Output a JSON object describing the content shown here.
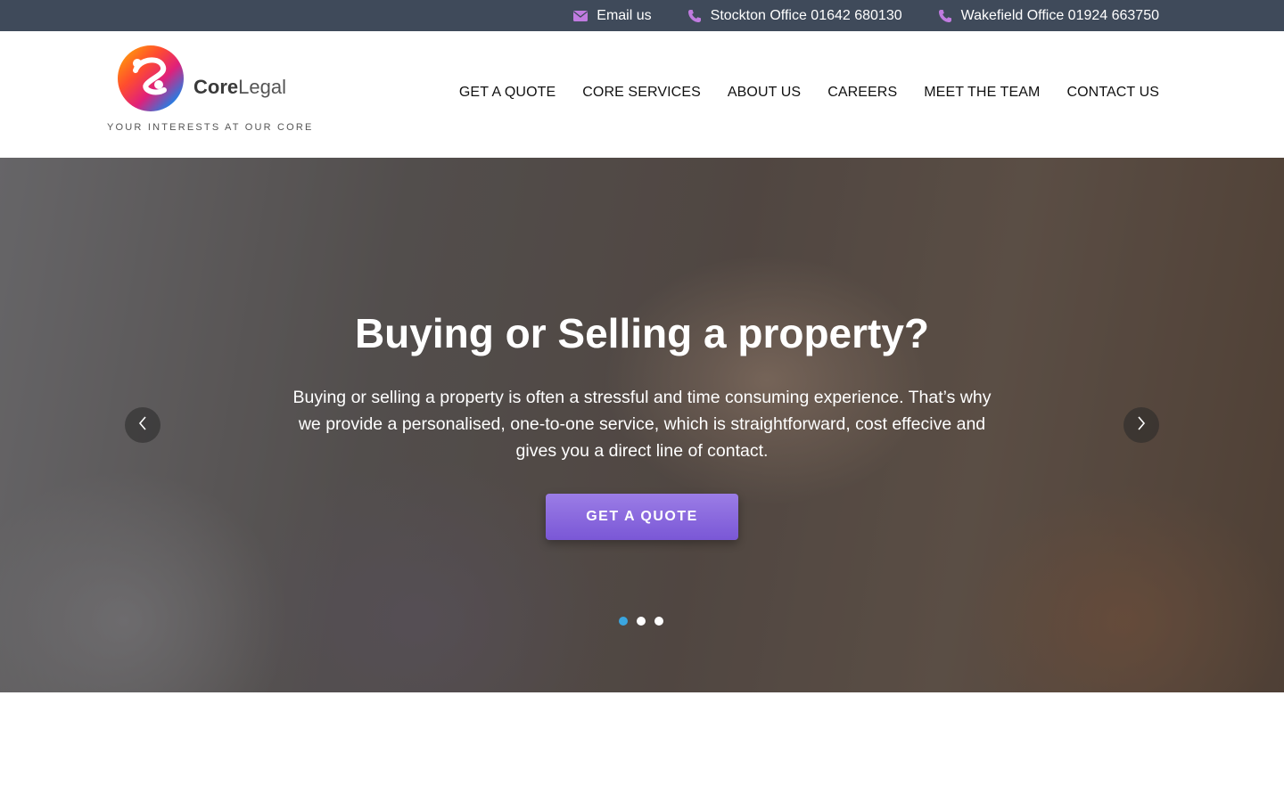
{
  "topbar": {
    "email": {
      "label": "Email us",
      "icon": "envelope-icon"
    },
    "stockton": {
      "label": "Stockton Office 01642 680130",
      "icon": "phone-icon"
    },
    "wakefield": {
      "label": "Wakefield Office 01924 663750",
      "icon": "phone-icon"
    },
    "icon_color": "#c07be0"
  },
  "brand": {
    "name_bold": "Core",
    "name_light": "Legal",
    "tagline": "YOUR INTERESTS AT OUR CORE"
  },
  "nav": {
    "items": [
      {
        "label": "GET A QUOTE"
      },
      {
        "label": "CORE SERVICES"
      },
      {
        "label": "ABOUT US"
      },
      {
        "label": "CAREERS"
      },
      {
        "label": "MEET THE TEAM"
      },
      {
        "label": "CONTACT US"
      }
    ]
  },
  "hero": {
    "title": "Buying or Selling a property?",
    "text": "Buying or selling a property is often a stressful and time consuming experience. That’s why we provide a personalised, one-to-one service, which is straightforward, cost effecive and gives you a direct line of contact.",
    "cta_label": "GET A QUOTE",
    "prev_icon": "chevron-left-icon",
    "next_icon": "chevron-right-icon",
    "slides": 3,
    "active_slide": 1,
    "accent": "#7a57d6",
    "dot_active_color": "#3aa6e0"
  }
}
